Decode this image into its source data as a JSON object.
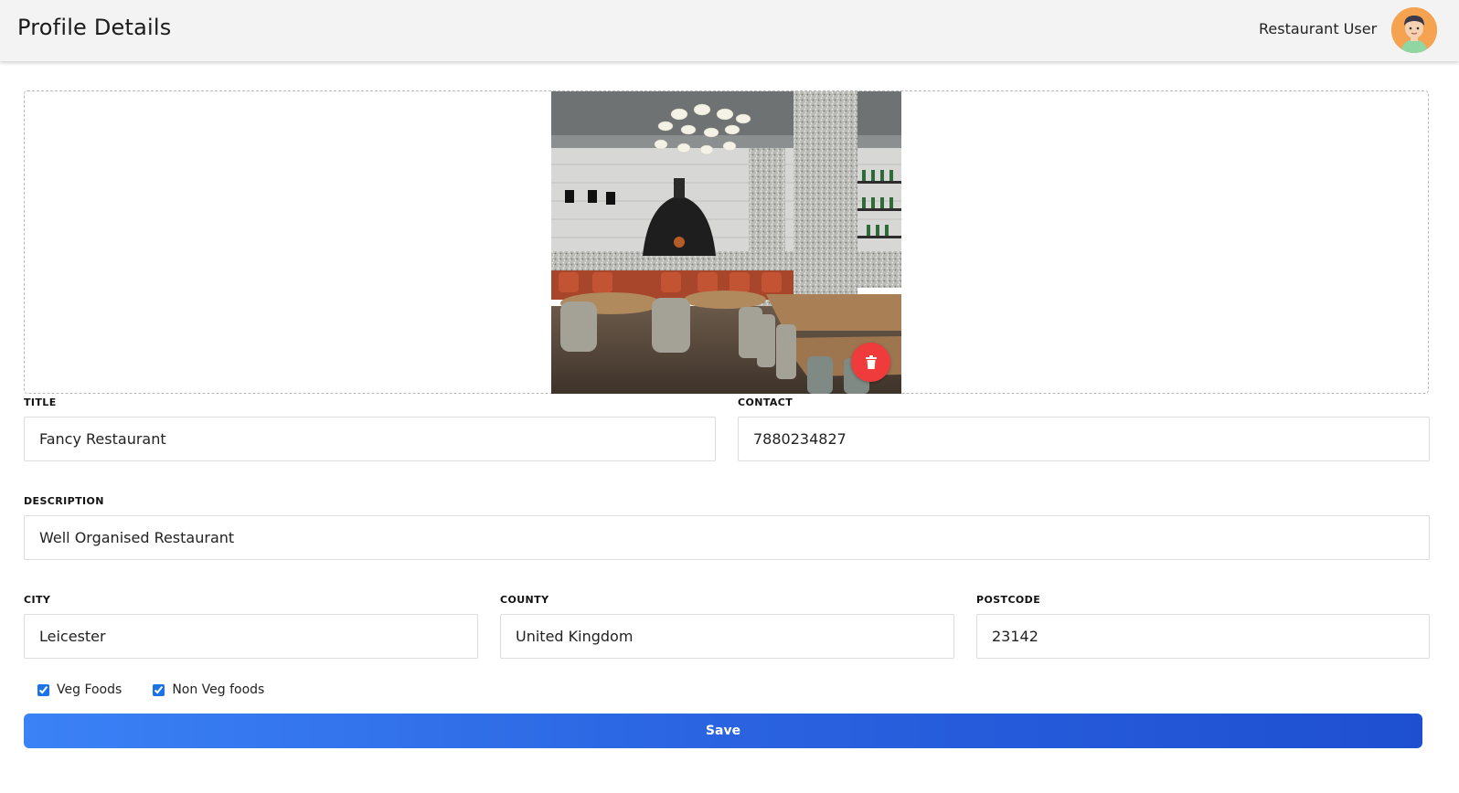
{
  "header": {
    "title": "Profile Details",
    "user_name": "Restaurant User"
  },
  "form": {
    "title": {
      "label": "TITLE",
      "value": "Fancy Restaurant"
    },
    "contact": {
      "label": "CONTACT",
      "value": "7880234827"
    },
    "description": {
      "label": "DESCRIPTION",
      "value": "Well Organised Restaurant"
    },
    "city": {
      "label": "CITY",
      "value": "Leicester"
    },
    "county": {
      "label": "COUNTY",
      "value": "United Kingdom"
    },
    "postcode": {
      "label": "POSTCODE",
      "value": "23142"
    },
    "checkboxes": [
      {
        "label": "Veg Foods",
        "checked": true
      },
      {
        "label": "Non Veg foods",
        "checked": true
      }
    ],
    "save_label": "Save"
  },
  "colors": {
    "primary": "#2a63e0",
    "delete": "#ef3b3b",
    "avatar": "#f5a251"
  }
}
